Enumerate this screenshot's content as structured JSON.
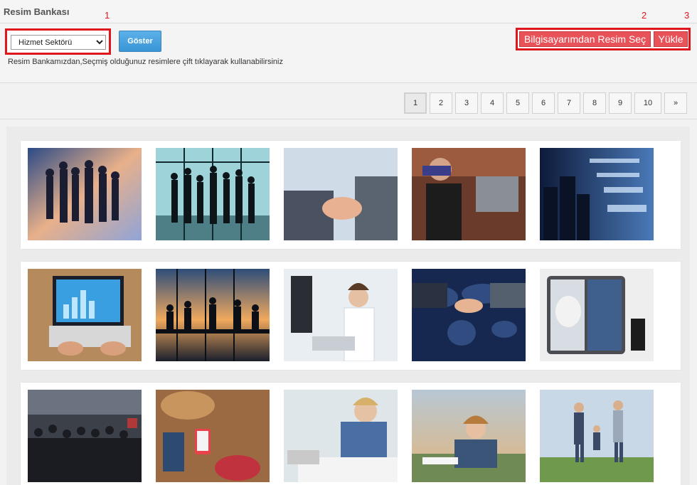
{
  "page": {
    "title": "Resim Bankası"
  },
  "annotations": [
    "1",
    "2",
    "3"
  ],
  "toolbar": {
    "sector_select": {
      "selected": "Hizmet Sektörü",
      "options": [
        "Hizmet Sektörü"
      ]
    },
    "show_button": "Göster",
    "hint": "Resim Bankamızdan,Seçmiş olduğunuz resimlere çift tıklayarak kullanabilirsiniz",
    "choose_button": "Bilgisayarımdan Resim Seç",
    "upload_button": "Yükle"
  },
  "pagination": {
    "pages": [
      "1",
      "2",
      "3",
      "4",
      "5",
      "6",
      "7",
      "8",
      "9",
      "10"
    ],
    "next": "»",
    "current": "1"
  },
  "colors": {
    "annotation": "#e0161d",
    "accent_button": "#3a95d6",
    "upload_button": "#e8535a"
  },
  "gallery": {
    "rows": [
      [
        "business-team-silhouettes",
        "team-silhouettes-window",
        "business-handshake",
        "barista-woman",
        "financial-numbers-city"
      ],
      [
        "laptop-charts",
        "meeting-silhouettes-sunset",
        "call-center-agent",
        "world-map-handshake",
        "open-suitcase-packing"
      ],
      [
        "crowded-train-station",
        "travel-accessories-wood",
        "businesswoman-writing",
        "woman-relaxing-outdoors",
        "family-running-field"
      ]
    ]
  }
}
